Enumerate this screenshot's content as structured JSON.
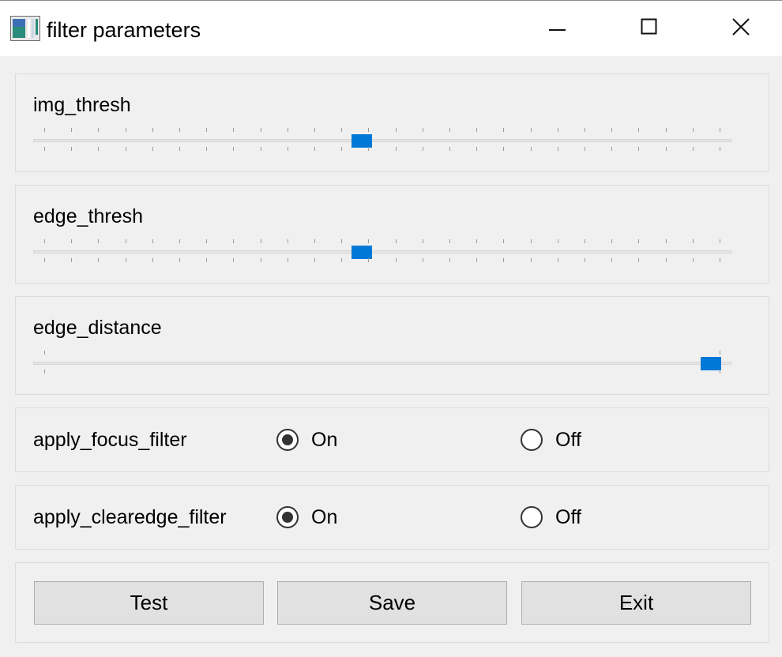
{
  "window": {
    "title": "filter parameters"
  },
  "icons": {
    "app": "app-icon",
    "minimize": "minimize-icon",
    "maximize": "maximize-icon",
    "close": "close-icon"
  },
  "sliders": [
    {
      "label": "img_thresh",
      "value_fraction": 0.47,
      "tick_count": 26
    },
    {
      "label": "edge_thresh",
      "value_fraction": 0.47,
      "tick_count": 26
    },
    {
      "label": "edge_distance",
      "value_fraction": 0.985,
      "tick_count": 2
    }
  ],
  "toggles": [
    {
      "label": "apply_focus_filter",
      "on_label": "On",
      "off_label": "Off",
      "selected": "On"
    },
    {
      "label": "apply_clearedge_filter",
      "on_label": "On",
      "off_label": "Off",
      "selected": "On"
    }
  ],
  "buttons": {
    "test": "Test",
    "save": "Save",
    "exit": "Exit"
  },
  "colors": {
    "accent": "#0078d7",
    "window_bg": "#f0f0f0",
    "titlebar_bg": "#ffffff"
  }
}
